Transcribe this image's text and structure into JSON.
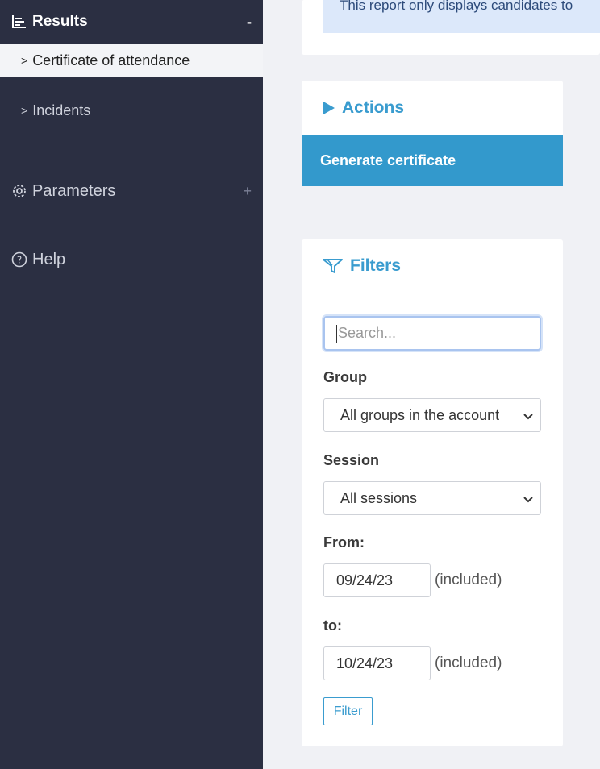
{
  "sidebar": {
    "header": {
      "label": "Results",
      "toggle": "-"
    },
    "items": [
      {
        "label": "Certificate of attendance",
        "chevron": ">"
      },
      {
        "label": "Incidents",
        "chevron": ">"
      }
    ],
    "sections": [
      {
        "label": "Parameters",
        "toggle": "+",
        "icon": "gear-icon"
      },
      {
        "label": "Help",
        "icon": "help-icon"
      }
    ]
  },
  "banner": {
    "text": "This report only displays candidates to"
  },
  "actions": {
    "title": "Actions",
    "generate_label": "Generate certificate"
  },
  "filters": {
    "title": "Filters",
    "search_placeholder": "Search...",
    "group_label": "Group",
    "group_value": "All groups in the account",
    "session_label": "Session",
    "session_value": "All sessions",
    "from_label": "From:",
    "from_value": "09/24/23",
    "to_label": "to:",
    "to_value": "10/24/23",
    "included_note": "(included)",
    "filter_button": "Filter"
  },
  "colors": {
    "accent": "#3399cc",
    "sidebar_bg": "#2b2f42",
    "banner_bg": "#dce8fa"
  }
}
